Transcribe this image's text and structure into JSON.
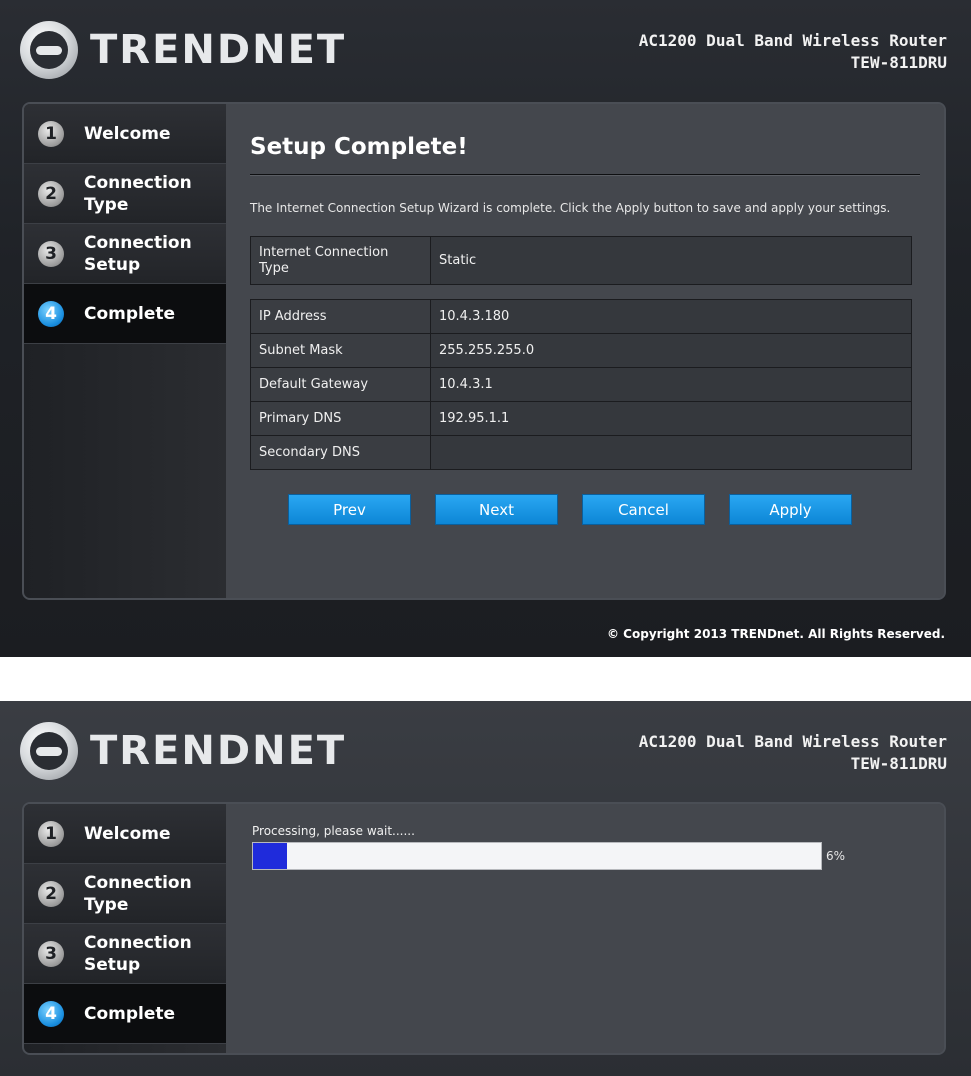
{
  "brand": {
    "logo_text": "TRENDNET",
    "model_line1": "AC1200 Dual Band Wireless Router",
    "model_line2": "TEW-811DRU"
  },
  "steps": [
    {
      "num": "1",
      "label": "Welcome"
    },
    {
      "num": "2",
      "label": "Connection Type"
    },
    {
      "num": "3",
      "label": "Connection Setup"
    },
    {
      "num": "4",
      "label": "Complete"
    }
  ],
  "active_step": "4",
  "complete_page": {
    "title": "Setup Complete!",
    "intro": "The Internet Connection Setup Wizard is complete. Click the Apply button to save and apply your settings.",
    "connection_type": {
      "label": "Internet Connection Type",
      "value": "Static"
    },
    "rows": [
      {
        "label": "IP Address",
        "value": "10.4.3.180"
      },
      {
        "label": "Subnet Mask",
        "value": "255.255.255.0"
      },
      {
        "label": "Default Gateway",
        "value": "10.4.3.1"
      },
      {
        "label": "Primary DNS",
        "value": "192.95.1.1"
      },
      {
        "label": "Secondary DNS",
        "value": ""
      }
    ],
    "buttons": {
      "prev": "Prev",
      "next": "Next",
      "cancel": "Cancel",
      "apply": "Apply"
    },
    "copyright": "© Copyright 2013 TRENDnet. All Rights Reserved."
  },
  "processing_page": {
    "message": "Processing, please wait......",
    "progress_percent": 6,
    "progress_text": "6%"
  },
  "colors": {
    "accent_blue": "#1a8fe0",
    "button_blue": "#0d86d6",
    "progress_fill": "#1f2bdb"
  }
}
